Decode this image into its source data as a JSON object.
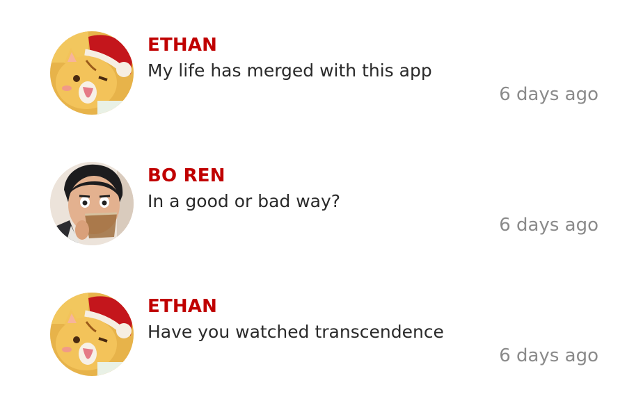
{
  "comments": [
    {
      "author": "ETHAN",
      "message": "My life has merged with this app",
      "time": "6 days ago",
      "avatar_icon": "cartoon-cat-santa-hat"
    },
    {
      "author": "BO REN",
      "message": "In a good or bad way?",
      "time": "6 days ago",
      "avatar_icon": "person-drinking-photo"
    },
    {
      "author": "ETHAN",
      "message": "Have you watched transcendence",
      "time": "6 days ago",
      "avatar_icon": "cartoon-cat-santa-hat"
    }
  ],
  "colors": {
    "author": "#c00000",
    "message": "#2a2a2a",
    "time": "#8a8a8a",
    "background": "#ffffff"
  }
}
